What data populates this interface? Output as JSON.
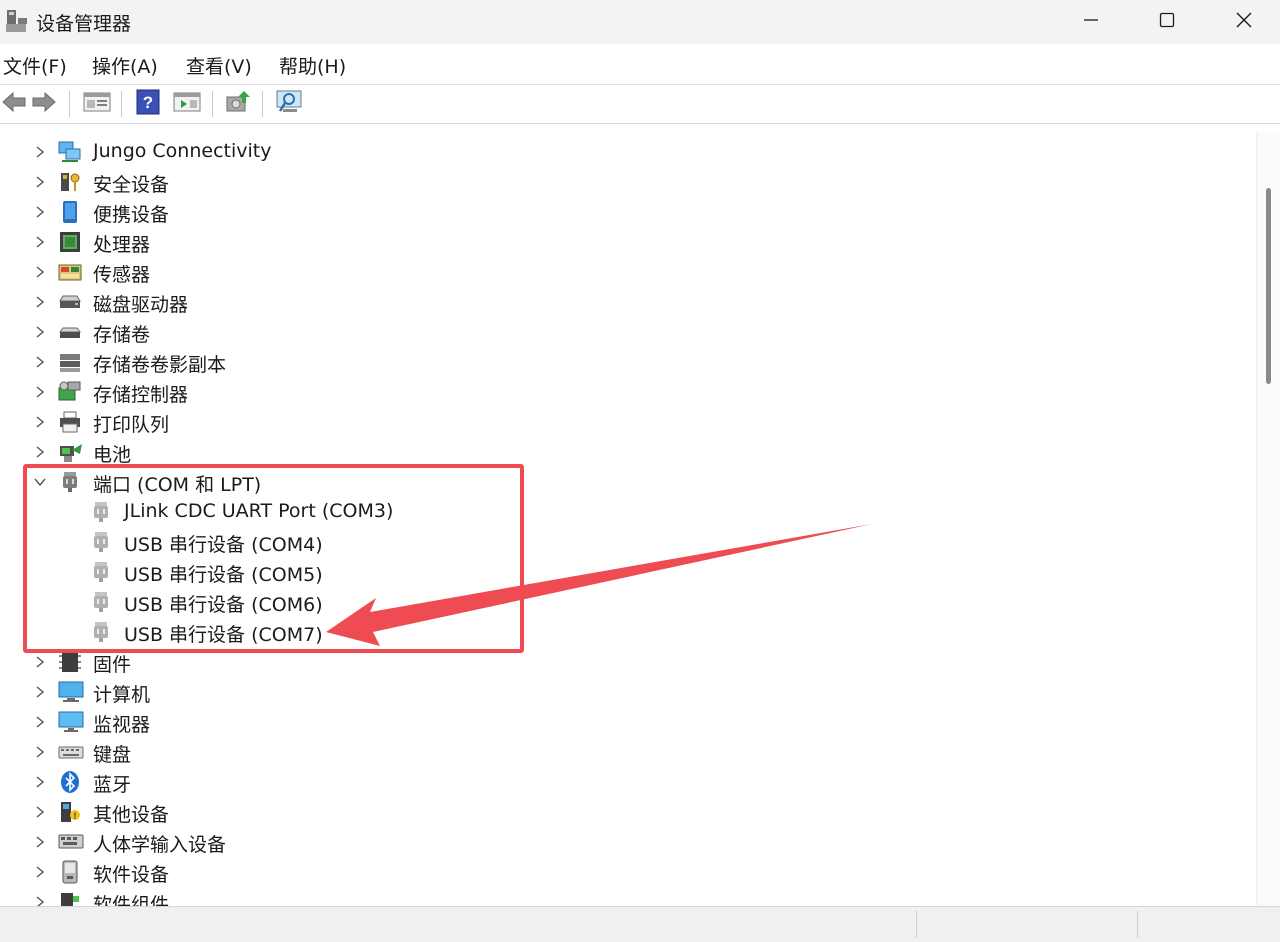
{
  "window": {
    "title": "设备管理器",
    "icons": {
      "app": "device-manager-icon",
      "minimize": "minimize-icon",
      "maximize": "maximize-icon",
      "close": "close-icon"
    }
  },
  "menu": [
    {
      "label": "文件(F)"
    },
    {
      "label": "操作(A)"
    },
    {
      "label": "查看(V)"
    },
    {
      "label": "帮助(H)"
    }
  ],
  "toolbar": {
    "buttons": [
      "back-arrow-icon",
      "forward-arrow-icon",
      "properties-icon",
      "help-icon",
      "show-hide-icon",
      "update-driver-icon",
      "scan-hardware-icon"
    ]
  },
  "tree": {
    "items": [
      {
        "label": "Jungo Connectivity",
        "icon": "network-monitor-icon",
        "expanded": false
      },
      {
        "label": "安全设备",
        "icon": "security-key-icon",
        "expanded": false
      },
      {
        "label": "便携设备",
        "icon": "portable-device-icon",
        "expanded": false
      },
      {
        "label": "处理器",
        "icon": "processor-chip-icon",
        "expanded": false
      },
      {
        "label": "传感器",
        "icon": "sensor-icon",
        "expanded": false
      },
      {
        "label": "磁盘驱动器",
        "icon": "disk-drive-icon",
        "expanded": false
      },
      {
        "label": "存储卷",
        "icon": "storage-volume-icon",
        "expanded": false
      },
      {
        "label": "存储卷卷影副本",
        "icon": "shadow-copy-icon",
        "expanded": false
      },
      {
        "label": "存储控制器",
        "icon": "storage-controller-icon",
        "expanded": false
      },
      {
        "label": "打印队列",
        "icon": "printer-icon",
        "expanded": false
      },
      {
        "label": "电池",
        "icon": "battery-icon",
        "expanded": false
      },
      {
        "label": "端口 (COM 和 LPT)",
        "icon": "port-connector-icon",
        "expanded": true,
        "children": [
          {
            "label": "JLink CDC UART Port (COM3)",
            "icon": "port-connector-icon"
          },
          {
            "label": "USB 串行设备 (COM4)",
            "icon": "port-connector-icon"
          },
          {
            "label": "USB 串行设备 (COM5)",
            "icon": "port-connector-icon"
          },
          {
            "label": "USB 串行设备 (COM6)",
            "icon": "port-connector-icon"
          },
          {
            "label": "USB 串行设备 (COM7)",
            "icon": "port-connector-icon"
          }
        ]
      },
      {
        "label": "固件",
        "icon": "firmware-chip-icon",
        "expanded": false
      },
      {
        "label": "计算机",
        "icon": "computer-icon",
        "expanded": false
      },
      {
        "label": "监视器",
        "icon": "monitor-icon",
        "expanded": false
      },
      {
        "label": "键盘",
        "icon": "keyboard-icon",
        "expanded": false
      },
      {
        "label": "蓝牙",
        "icon": "bluetooth-icon",
        "expanded": false
      },
      {
        "label": "其他设备",
        "icon": "other-device-icon",
        "expanded": false
      },
      {
        "label": "人体学输入设备",
        "icon": "hid-keyboard-icon",
        "expanded": false
      },
      {
        "label": "软件设备",
        "icon": "software-device-icon",
        "expanded": false
      },
      {
        "label": "软件组件",
        "icon": "software-component-icon",
        "expanded": false
      }
    ]
  },
  "colors": {
    "annotation": "#ee4b52",
    "titlebar": "#f3f3f3",
    "accent": "#1f6fd1"
  }
}
